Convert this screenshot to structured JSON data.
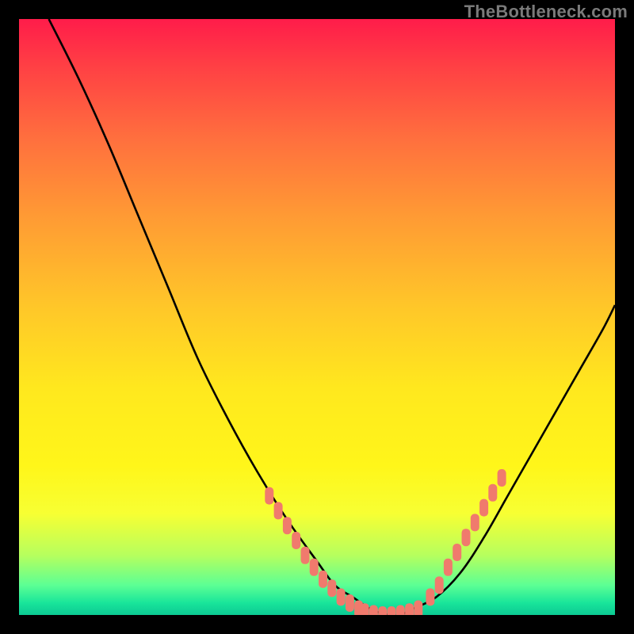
{
  "watermark": "TheBottleneck.com",
  "colors": {
    "background": "#000000",
    "gradient_top": "#ff1c4a",
    "gradient_bottom": "#0cc993",
    "curve": "#000000",
    "marker": "#f07a6d"
  },
  "chart_data": {
    "type": "line",
    "title": "",
    "xlabel": "",
    "ylabel": "",
    "xlim": [
      0,
      100
    ],
    "ylim": [
      0,
      100
    ],
    "grid": false,
    "legend": false,
    "series": [
      {
        "name": "bottleneck-curve",
        "x": [
          5,
          10,
          15,
          20,
          25,
          30,
          35,
          40,
          45,
          50,
          53,
          56,
          59,
          62,
          64,
          66,
          70,
          74,
          78,
          82,
          86,
          90,
          94,
          98,
          100
        ],
        "y": [
          100,
          90,
          79,
          67,
          55,
          43,
          33,
          24,
          16,
          9,
          5,
          3,
          1,
          0,
          0,
          1,
          3,
          7,
          13,
          20,
          27,
          34,
          41,
          48,
          52
        ]
      }
    ],
    "markers_left": {
      "name": "left-cluster",
      "x": [
        42,
        43.5,
        45,
        46.5,
        48,
        49.5,
        51,
        52.5,
        54,
        55.5,
        57
      ],
      "y": [
        20,
        17.5,
        15,
        12.5,
        10,
        8,
        6,
        4.5,
        3,
        2,
        1
      ]
    },
    "markers_bottom": {
      "name": "bottom-cluster",
      "x": [
        58,
        59.5,
        61,
        62.5,
        64,
        65.5,
        67
      ],
      "y": [
        0.5,
        0.2,
        0,
        0,
        0.2,
        0.5,
        1
      ]
    },
    "markers_right": {
      "name": "right-cluster",
      "x": [
        69,
        70.5,
        72,
        73.5,
        75,
        76.5,
        78,
        79.5,
        81
      ],
      "y": [
        3,
        5,
        8,
        10.5,
        13,
        15.5,
        18,
        20.5,
        23
      ]
    }
  }
}
